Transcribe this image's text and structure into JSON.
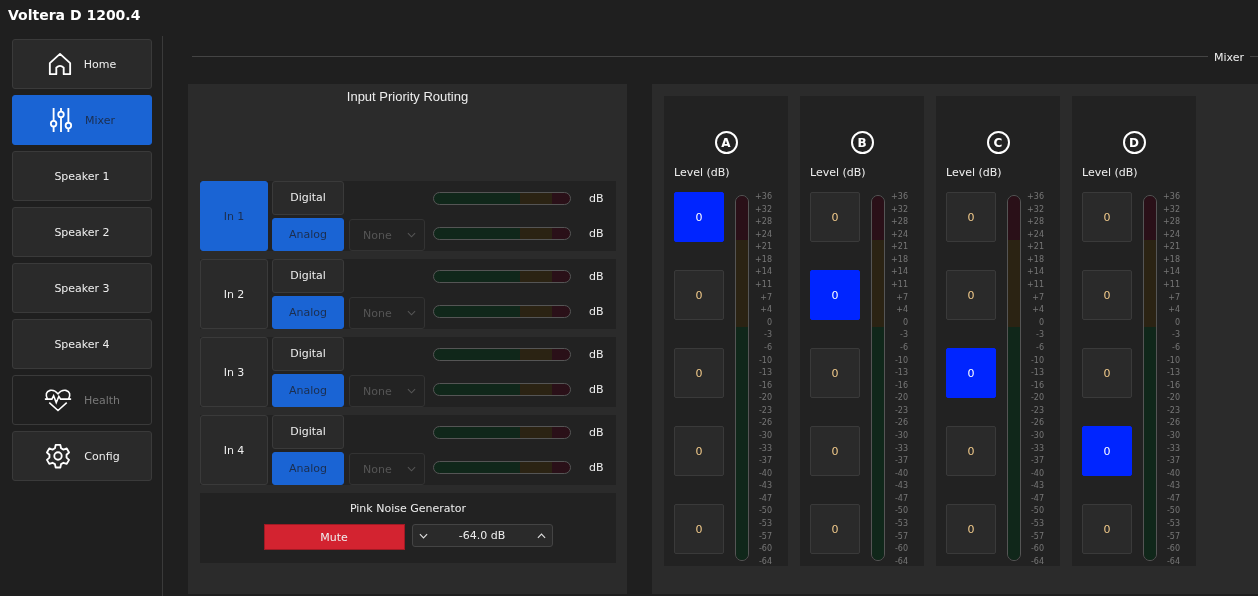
{
  "window": {
    "title": "Voltera D 1200.4"
  },
  "sidebar": {
    "items": [
      {
        "label": "Home",
        "kind": "home",
        "selected": false,
        "disabled": false
      },
      {
        "label": "Mixer",
        "kind": "mixer",
        "selected": true,
        "disabled": false
      },
      {
        "label": "Speaker 1",
        "kind": "plain",
        "selected": false,
        "disabled": false
      },
      {
        "label": "Speaker 2",
        "kind": "plain",
        "selected": false,
        "disabled": false
      },
      {
        "label": "Speaker 3",
        "kind": "plain",
        "selected": false,
        "disabled": false
      },
      {
        "label": "Speaker 4",
        "kind": "plain",
        "selected": false,
        "disabled": false
      },
      {
        "label": "Health",
        "kind": "health",
        "selected": false,
        "disabled": true
      },
      {
        "label": "Config",
        "kind": "config",
        "selected": false,
        "disabled": false
      }
    ]
  },
  "section_title": "Mixer",
  "routing": {
    "title": "Input Priority Routing",
    "inputs": [
      {
        "name": "In 1",
        "selected": true,
        "digital": {
          "label": "Digital",
          "selected": false
        },
        "analog": {
          "label": "Analog",
          "selected": true
        },
        "source": {
          "value": "None",
          "disabled": true
        },
        "meter_units": [
          "dB",
          "dB"
        ]
      },
      {
        "name": "In 2",
        "selected": false,
        "digital": {
          "label": "Digital",
          "selected": false
        },
        "analog": {
          "label": "Analog",
          "selected": true
        },
        "source": {
          "value": "None",
          "disabled": true
        },
        "meter_units": [
          "dB",
          "dB"
        ]
      },
      {
        "name": "In 3",
        "selected": false,
        "digital": {
          "label": "Digital",
          "selected": false
        },
        "analog": {
          "label": "Analog",
          "selected": true
        },
        "source": {
          "value": "None",
          "disabled": true
        },
        "meter_units": [
          "dB",
          "dB"
        ]
      },
      {
        "name": "In 4",
        "selected": false,
        "digital": {
          "label": "Digital",
          "selected": false
        },
        "analog": {
          "label": "Analog",
          "selected": true
        },
        "source": {
          "value": "None",
          "disabled": true
        },
        "meter_units": [
          "dB",
          "dB"
        ]
      }
    ],
    "pink_noise": {
      "title": "Pink Noise Generator",
      "mute": {
        "label": "Mute",
        "on": true
      },
      "level_value": "-64.0 dB"
    }
  },
  "channels": [
    {
      "letter": "A",
      "level_label": "Level (dB)",
      "buttons": [
        {
          "label": "0",
          "selected": true
        },
        {
          "label": "0",
          "selected": false
        },
        {
          "label": "0",
          "selected": false
        },
        {
          "label": "0",
          "selected": false
        },
        {
          "label": "0",
          "selected": false
        }
      ],
      "scale": [
        "+36",
        "+32",
        "+28",
        "+24",
        "+21",
        "+18",
        "+14",
        "+11",
        "+7",
        "+4",
        "0",
        "-3",
        "-6",
        "-10",
        "-13",
        "-16",
        "-20",
        "-23",
        "-26",
        "-30",
        "-33",
        "-37",
        "-40",
        "-43",
        "-47",
        "-50",
        "-53",
        "-57",
        "-60",
        "-64"
      ]
    },
    {
      "letter": "B",
      "level_label": "Level (dB)",
      "buttons": [
        {
          "label": "0",
          "selected": false
        },
        {
          "label": "0",
          "selected": true
        },
        {
          "label": "0",
          "selected": false
        },
        {
          "label": "0",
          "selected": false
        },
        {
          "label": "0",
          "selected": false
        }
      ],
      "scale": [
        "+36",
        "+32",
        "+28",
        "+24",
        "+21",
        "+18",
        "+14",
        "+11",
        "+7",
        "+4",
        "0",
        "-3",
        "-6",
        "-10",
        "-13",
        "-16",
        "-20",
        "-23",
        "-26",
        "-30",
        "-33",
        "-37",
        "-40",
        "-43",
        "-47",
        "-50",
        "-53",
        "-57",
        "-60",
        "-64"
      ]
    },
    {
      "letter": "C",
      "level_label": "Level (dB)",
      "buttons": [
        {
          "label": "0",
          "selected": false
        },
        {
          "label": "0",
          "selected": false
        },
        {
          "label": "0",
          "selected": true
        },
        {
          "label": "0",
          "selected": false
        },
        {
          "label": "0",
          "selected": false
        }
      ],
      "scale": [
        "+36",
        "+32",
        "+28",
        "+24",
        "+21",
        "+18",
        "+14",
        "+11",
        "+7",
        "+4",
        "0",
        "-3",
        "-6",
        "-10",
        "-13",
        "-16",
        "-20",
        "-23",
        "-26",
        "-30",
        "-33",
        "-37",
        "-40",
        "-43",
        "-47",
        "-50",
        "-53",
        "-57",
        "-60",
        "-64"
      ]
    },
    {
      "letter": "D",
      "level_label": "Level (dB)",
      "buttons": [
        {
          "label": "0",
          "selected": false
        },
        {
          "label": "0",
          "selected": false
        },
        {
          "label": "0",
          "selected": false
        },
        {
          "label": "0",
          "selected": true
        },
        {
          "label": "0",
          "selected": false
        }
      ],
      "scale": [
        "+36",
        "+32",
        "+28",
        "+24",
        "+21",
        "+18",
        "+14",
        "+11",
        "+7",
        "+4",
        "0",
        "-3",
        "-6",
        "-10",
        "-13",
        "-16",
        "-20",
        "-23",
        "-26",
        "-30",
        "-33",
        "-37",
        "-40",
        "-43",
        "-47",
        "-50",
        "-53",
        "-57",
        "-60",
        "-64"
      ]
    }
  ]
}
